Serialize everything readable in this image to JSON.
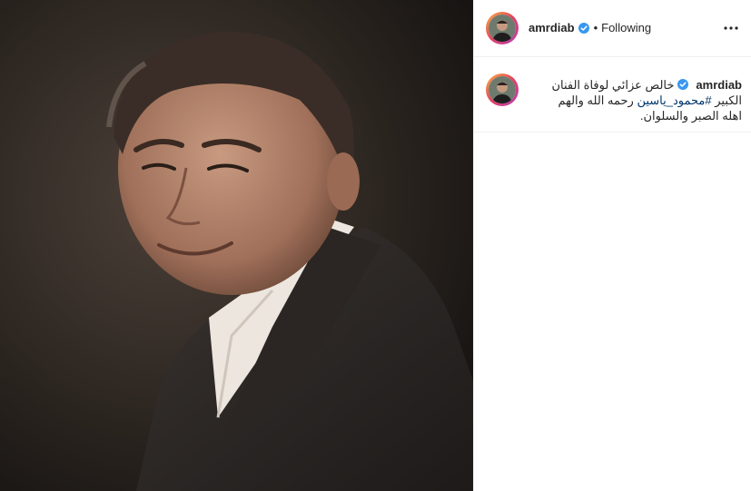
{
  "post": {
    "username": "amrdiab",
    "verified": true,
    "separator": "•",
    "follow_state": "Following",
    "more_icon": "more-horizontal-icon"
  },
  "caption": {
    "username": "amrdiab",
    "line1": "خالص عزائي لوفاة الفنان",
    "line2_prefix": "الكبير",
    "hashtag": "#محمود_ياسين",
    "line2_suffix": "رحمه الله والهم",
    "line3": "اهله الصبر والسلوان."
  },
  "colors": {
    "verified": "#3897f0",
    "link": "#00376b",
    "text": "#262626",
    "divider": "#efefef"
  }
}
